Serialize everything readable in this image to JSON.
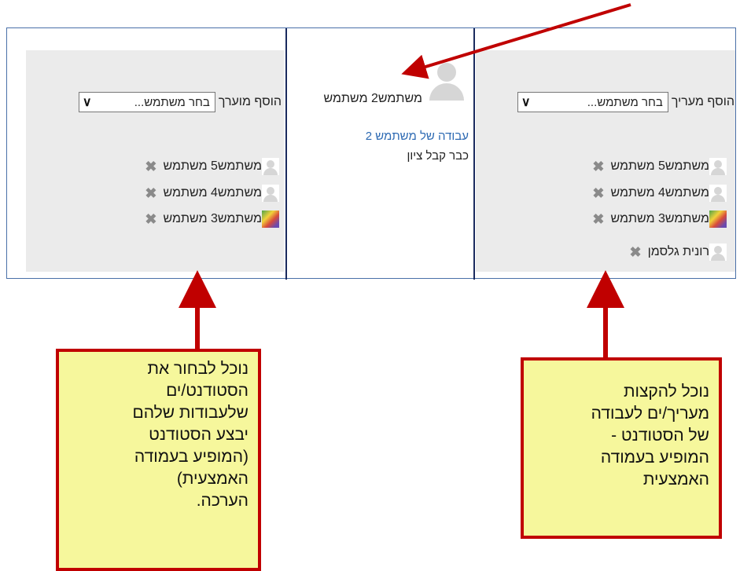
{
  "graders_column": {
    "add_label": "הוסף מעריך",
    "select_placeholder": "בחר משתמש...",
    "users": [
      {
        "name": "משתמש5 משתמש",
        "avatar": "default"
      },
      {
        "name": "משתמש4 משתמש",
        "avatar": "default"
      },
      {
        "name": "משתמש3 משתמש",
        "avatar": "photo"
      },
      {
        "name": "רונית גלסמן",
        "avatar": "default"
      }
    ]
  },
  "student_column": {
    "student_name": "משתמש2 משתמש",
    "submission_link": "עבודה של משתמש 2",
    "status": "כבר קבל ציון"
  },
  "gradees_column": {
    "add_label": "הוסף מוערך",
    "select_placeholder": "בחר משתמש...",
    "users": [
      {
        "name": "משתמש5 משתמש",
        "avatar": "default"
      },
      {
        "name": "משתמש4 משתמש",
        "avatar": "default"
      },
      {
        "name": "משתמש3 משתמש",
        "avatar": "photo"
      }
    ]
  },
  "notes": {
    "left_lines": [
      "נוכל לבחור את",
      "הסטודנט/ים",
      "שלעבודות שלהם",
      "יבצע הסטודנט",
      "(המופיע בעמודה",
      "האמצעית)",
      "הערכה."
    ],
    "right_lines": [
      "נוכל להקצות",
      "מעריך/ים לעבודה",
      "של הסטודנט -",
      "המופיע בעמודה",
      "האמצעית"
    ]
  },
  "colors": {
    "note_bg": "#f6f79c",
    "note_border": "#c00000",
    "arrow": "#c00000",
    "panel_bg": "#ebebeb",
    "link": "#2d6ab3"
  },
  "icons": {
    "remove": "close-x-icon",
    "dropdown": "chevron-down-icon",
    "user": "user-avatar-icon"
  }
}
